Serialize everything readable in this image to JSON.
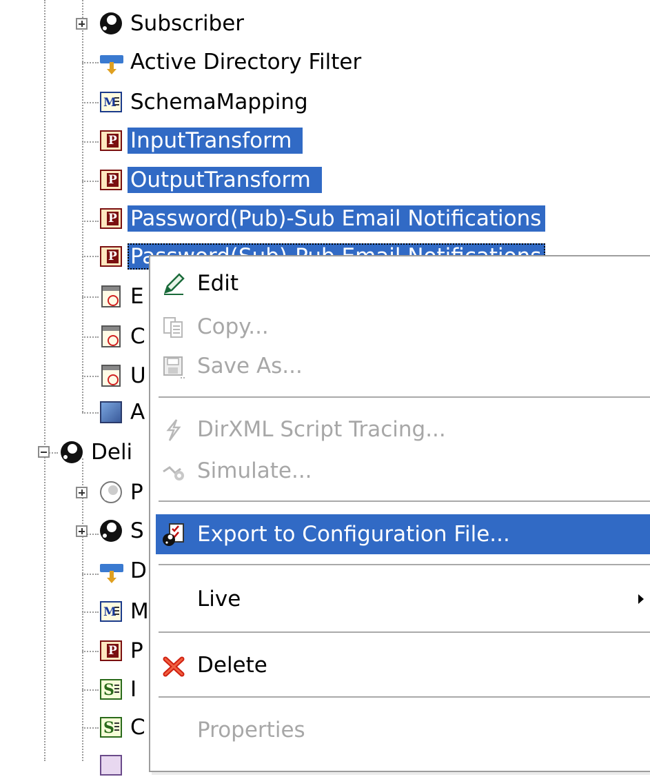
{
  "tree": {
    "visible_items": [
      {
        "label": "Subscriber",
        "icon": "yin-yang-icon"
      },
      {
        "label": "Active Directory Filter",
        "icon": "filter-icon"
      },
      {
        "label": "SchemaMapping",
        "icon": "schema-map-policy-icon"
      },
      {
        "label": "InputTransform",
        "icon": "policy-p-icon"
      },
      {
        "label": "OutputTransform",
        "icon": "policy-p-icon"
      },
      {
        "label": "Password(Pub)-Sub Email Notifications",
        "icon": "policy-p-icon"
      },
      {
        "label": "Password(Sub)-Pub Email Notifications",
        "icon": "policy-p-icon"
      },
      {
        "label": "E",
        "icon": "calendar-icon"
      },
      {
        "label": "C",
        "icon": "calendar-icon"
      },
      {
        "label": "U",
        "icon": "calendar-icon"
      },
      {
        "label": "A",
        "icon": "application-icon"
      },
      {
        "label": "Deli",
        "icon": "yin-yang-icon"
      },
      {
        "label": "P",
        "icon": "yin-yang-outline-icon"
      },
      {
        "label": "S",
        "icon": "yin-yang-icon"
      },
      {
        "label": "D",
        "icon": "filter-icon"
      },
      {
        "label": "M",
        "icon": "schema-map-policy-icon"
      },
      {
        "label": "P",
        "icon": "policy-p-icon"
      },
      {
        "label": "I",
        "icon": "stylesheet-s-icon"
      },
      {
        "label": "C",
        "icon": "stylesheet-s-icon"
      }
    ],
    "selection_color": "#316ac5"
  },
  "context_menu": {
    "items": [
      {
        "label": "Edit",
        "icon": "pencil-icon",
        "enabled": true
      },
      {
        "label": "Copy...",
        "icon": "copy-icon",
        "enabled": false
      },
      {
        "label": "Save As...",
        "icon": "save-disk-icon",
        "enabled": false
      },
      {
        "label": "DirXML Script Tracing...",
        "icon": "trace-lightning-icon",
        "enabled": false
      },
      {
        "label": "Simulate...",
        "icon": "simulate-icon",
        "enabled": false
      },
      {
        "label": "Export to Configuration File...",
        "icon": "export-config-icon",
        "enabled": true,
        "highlighted": true
      },
      {
        "label": "Live",
        "has_submenu": true,
        "enabled": true
      },
      {
        "label": "Delete",
        "icon": "delete-x-icon",
        "enabled": true
      },
      {
        "label": "Properties",
        "enabled": false
      }
    ],
    "highlight_color": "#316ac5",
    "disabled_text_color": "#a7a7a7"
  }
}
